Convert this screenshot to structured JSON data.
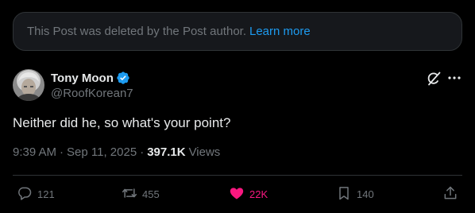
{
  "notice": {
    "text": "This Post was deleted by the Post author.",
    "link": "Learn more"
  },
  "author": {
    "display_name": "Tony Moon",
    "handle": "@RoofKorean7"
  },
  "post": {
    "text": "Neither did he, so what's your point?"
  },
  "meta": {
    "time": "9:39 AM",
    "date": "Sep 11, 2025",
    "views_count": "397.1K",
    "views_label": "Views"
  },
  "actions": {
    "replies": "121",
    "reposts": "455",
    "likes": "22K",
    "bookmarks": "140"
  },
  "colors": {
    "accent": "#1d9bf0",
    "like": "#f91880",
    "muted": "#71767b"
  },
  "icons": [
    "verified-badge-icon",
    "grok-icon",
    "more-icon",
    "reply-icon",
    "repost-icon",
    "heart-icon",
    "bookmark-icon",
    "share-icon"
  ]
}
